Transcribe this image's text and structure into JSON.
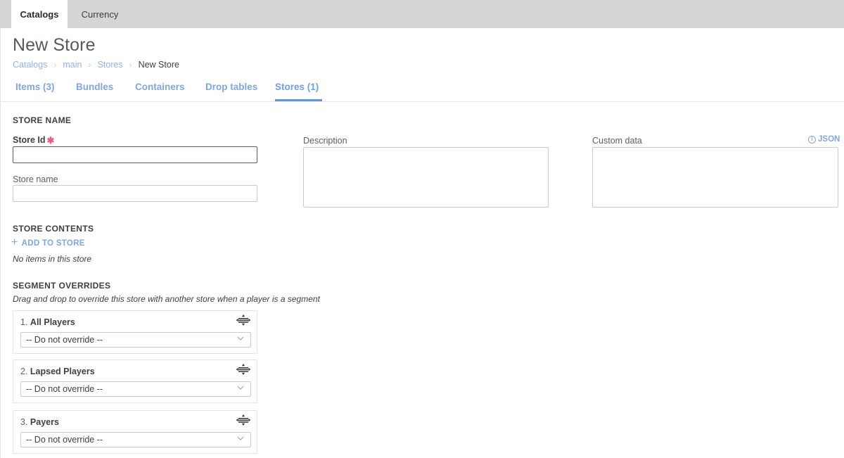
{
  "window_tabs": [
    {
      "label": "Catalogs",
      "active": true
    },
    {
      "label": "Currency",
      "active": false
    }
  ],
  "header": {
    "title": "New Store",
    "breadcrumb": [
      {
        "label": "Catalogs",
        "link": true
      },
      {
        "label": "main",
        "link": true
      },
      {
        "label": "Stores",
        "link": true
      },
      {
        "label": "New Store",
        "link": false
      }
    ],
    "separator": "›"
  },
  "subnav": {
    "tabs": [
      {
        "label": "Items (3)",
        "active": false
      },
      {
        "label": "Bundles",
        "active": false
      },
      {
        "label": "Containers",
        "active": false
      },
      {
        "label": "Drop tables",
        "active": false
      },
      {
        "label": "Stores (1)",
        "active": true
      }
    ]
  },
  "store_name_section": {
    "heading": "STORE NAME",
    "store_id": {
      "label": "Store Id",
      "required_marker": "✱",
      "value": "",
      "placeholder": ""
    },
    "store_name": {
      "label": "Store name",
      "value": "",
      "placeholder": ""
    },
    "description": {
      "label": "Description",
      "value": "",
      "placeholder": ""
    },
    "custom_data": {
      "label": "Custom data",
      "value": "",
      "placeholder": "",
      "json_hint": "JSON",
      "info_glyph": "i"
    }
  },
  "store_contents_section": {
    "heading": "STORE CONTENTS",
    "add_label": "ADD TO STORE",
    "add_icon": "+",
    "empty_text": "No items in this store"
  },
  "segment_overrides_section": {
    "heading": "SEGMENT OVERRIDES",
    "description": "Drag and drop to override this store with another store when a player is a segment",
    "default_option": "-- Do not override --",
    "items": [
      {
        "index": "1.",
        "name": "All Players",
        "selected": "-- Do not override --"
      },
      {
        "index": "2.",
        "name": "Lapsed Players",
        "selected": "-- Do not override --"
      },
      {
        "index": "3.",
        "name": "Payers",
        "selected": "-- Do not override --"
      }
    ]
  },
  "colors": {
    "accent_blue": "#5c96e6",
    "link_blue": "#7da7e8",
    "required_red": "#ea5c7e",
    "chrome_gray": "#d5d5d5",
    "text_dark": "#3c4043"
  }
}
